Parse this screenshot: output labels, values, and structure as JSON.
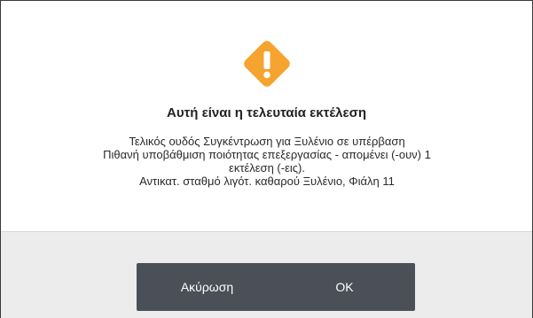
{
  "dialog": {
    "icon": "warning-icon",
    "accent_color": "#f5a430",
    "title": "Αυτή είναι η τελευταία εκτέλεση",
    "message_lines": [
      "Τελικός ουδός Συγκέντρωση για Ξυλένιο σε υπέρβαση",
      "Πιθανή υποβάθμιση ποιότητας επεξεργασίας - απομένει (-ουν) 1",
      "εκτέλεση (-εις).",
      "Αντικατ. σταθμό λιγότ. καθαρού Ξυλένιο, Φιάλη 11"
    ],
    "buttons": {
      "cancel_label": "Ακύρωση",
      "ok_label": "OK"
    }
  }
}
